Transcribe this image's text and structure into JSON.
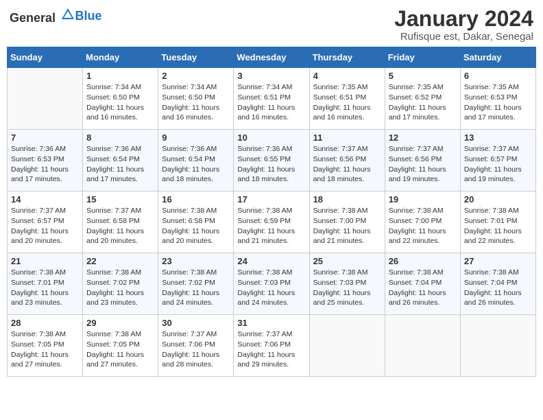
{
  "header": {
    "logo_general": "General",
    "logo_blue": "Blue",
    "month_title": "January 2024",
    "location": "Rufisque est, Dakar, Senegal"
  },
  "days_of_week": [
    "Sunday",
    "Monday",
    "Tuesday",
    "Wednesday",
    "Thursday",
    "Friday",
    "Saturday"
  ],
  "weeks": [
    [
      {
        "day": "",
        "info": ""
      },
      {
        "day": "1",
        "info": "Sunrise: 7:34 AM\nSunset: 6:50 PM\nDaylight: 11 hours and 16 minutes."
      },
      {
        "day": "2",
        "info": "Sunrise: 7:34 AM\nSunset: 6:50 PM\nDaylight: 11 hours and 16 minutes."
      },
      {
        "day": "3",
        "info": "Sunrise: 7:34 AM\nSunset: 6:51 PM\nDaylight: 11 hours and 16 minutes."
      },
      {
        "day": "4",
        "info": "Sunrise: 7:35 AM\nSunset: 6:51 PM\nDaylight: 11 hours and 16 minutes."
      },
      {
        "day": "5",
        "info": "Sunrise: 7:35 AM\nSunset: 6:52 PM\nDaylight: 11 hours and 17 minutes."
      },
      {
        "day": "6",
        "info": "Sunrise: 7:35 AM\nSunset: 6:53 PM\nDaylight: 11 hours and 17 minutes."
      }
    ],
    [
      {
        "day": "7",
        "info": "Sunrise: 7:36 AM\nSunset: 6:53 PM\nDaylight: 11 hours and 17 minutes."
      },
      {
        "day": "8",
        "info": "Sunrise: 7:36 AM\nSunset: 6:54 PM\nDaylight: 11 hours and 17 minutes."
      },
      {
        "day": "9",
        "info": "Sunrise: 7:36 AM\nSunset: 6:54 PM\nDaylight: 11 hours and 18 minutes."
      },
      {
        "day": "10",
        "info": "Sunrise: 7:36 AM\nSunset: 6:55 PM\nDaylight: 11 hours and 18 minutes."
      },
      {
        "day": "11",
        "info": "Sunrise: 7:37 AM\nSunset: 6:56 PM\nDaylight: 11 hours and 18 minutes."
      },
      {
        "day": "12",
        "info": "Sunrise: 7:37 AM\nSunset: 6:56 PM\nDaylight: 11 hours and 19 minutes."
      },
      {
        "day": "13",
        "info": "Sunrise: 7:37 AM\nSunset: 6:57 PM\nDaylight: 11 hours and 19 minutes."
      }
    ],
    [
      {
        "day": "14",
        "info": "Sunrise: 7:37 AM\nSunset: 6:57 PM\nDaylight: 11 hours and 20 minutes."
      },
      {
        "day": "15",
        "info": "Sunrise: 7:37 AM\nSunset: 6:58 PM\nDaylight: 11 hours and 20 minutes."
      },
      {
        "day": "16",
        "info": "Sunrise: 7:38 AM\nSunset: 6:58 PM\nDaylight: 11 hours and 20 minutes."
      },
      {
        "day": "17",
        "info": "Sunrise: 7:38 AM\nSunset: 6:59 PM\nDaylight: 11 hours and 21 minutes."
      },
      {
        "day": "18",
        "info": "Sunrise: 7:38 AM\nSunset: 7:00 PM\nDaylight: 11 hours and 21 minutes."
      },
      {
        "day": "19",
        "info": "Sunrise: 7:38 AM\nSunset: 7:00 PM\nDaylight: 11 hours and 22 minutes."
      },
      {
        "day": "20",
        "info": "Sunrise: 7:38 AM\nSunset: 7:01 PM\nDaylight: 11 hours and 22 minutes."
      }
    ],
    [
      {
        "day": "21",
        "info": "Sunrise: 7:38 AM\nSunset: 7:01 PM\nDaylight: 11 hours and 23 minutes."
      },
      {
        "day": "22",
        "info": "Sunrise: 7:38 AM\nSunset: 7:02 PM\nDaylight: 11 hours and 23 minutes."
      },
      {
        "day": "23",
        "info": "Sunrise: 7:38 AM\nSunset: 7:02 PM\nDaylight: 11 hours and 24 minutes."
      },
      {
        "day": "24",
        "info": "Sunrise: 7:38 AM\nSunset: 7:03 PM\nDaylight: 11 hours and 24 minutes."
      },
      {
        "day": "25",
        "info": "Sunrise: 7:38 AM\nSunset: 7:03 PM\nDaylight: 11 hours and 25 minutes."
      },
      {
        "day": "26",
        "info": "Sunrise: 7:38 AM\nSunset: 7:04 PM\nDaylight: 11 hours and 26 minutes."
      },
      {
        "day": "27",
        "info": "Sunrise: 7:38 AM\nSunset: 7:04 PM\nDaylight: 11 hours and 26 minutes."
      }
    ],
    [
      {
        "day": "28",
        "info": "Sunrise: 7:38 AM\nSunset: 7:05 PM\nDaylight: 11 hours and 27 minutes."
      },
      {
        "day": "29",
        "info": "Sunrise: 7:38 AM\nSunset: 7:05 PM\nDaylight: 11 hours and 27 minutes."
      },
      {
        "day": "30",
        "info": "Sunrise: 7:37 AM\nSunset: 7:06 PM\nDaylight: 11 hours and 28 minutes."
      },
      {
        "day": "31",
        "info": "Sunrise: 7:37 AM\nSunset: 7:06 PM\nDaylight: 11 hours and 29 minutes."
      },
      {
        "day": "",
        "info": ""
      },
      {
        "day": "",
        "info": ""
      },
      {
        "day": "",
        "info": ""
      }
    ]
  ]
}
